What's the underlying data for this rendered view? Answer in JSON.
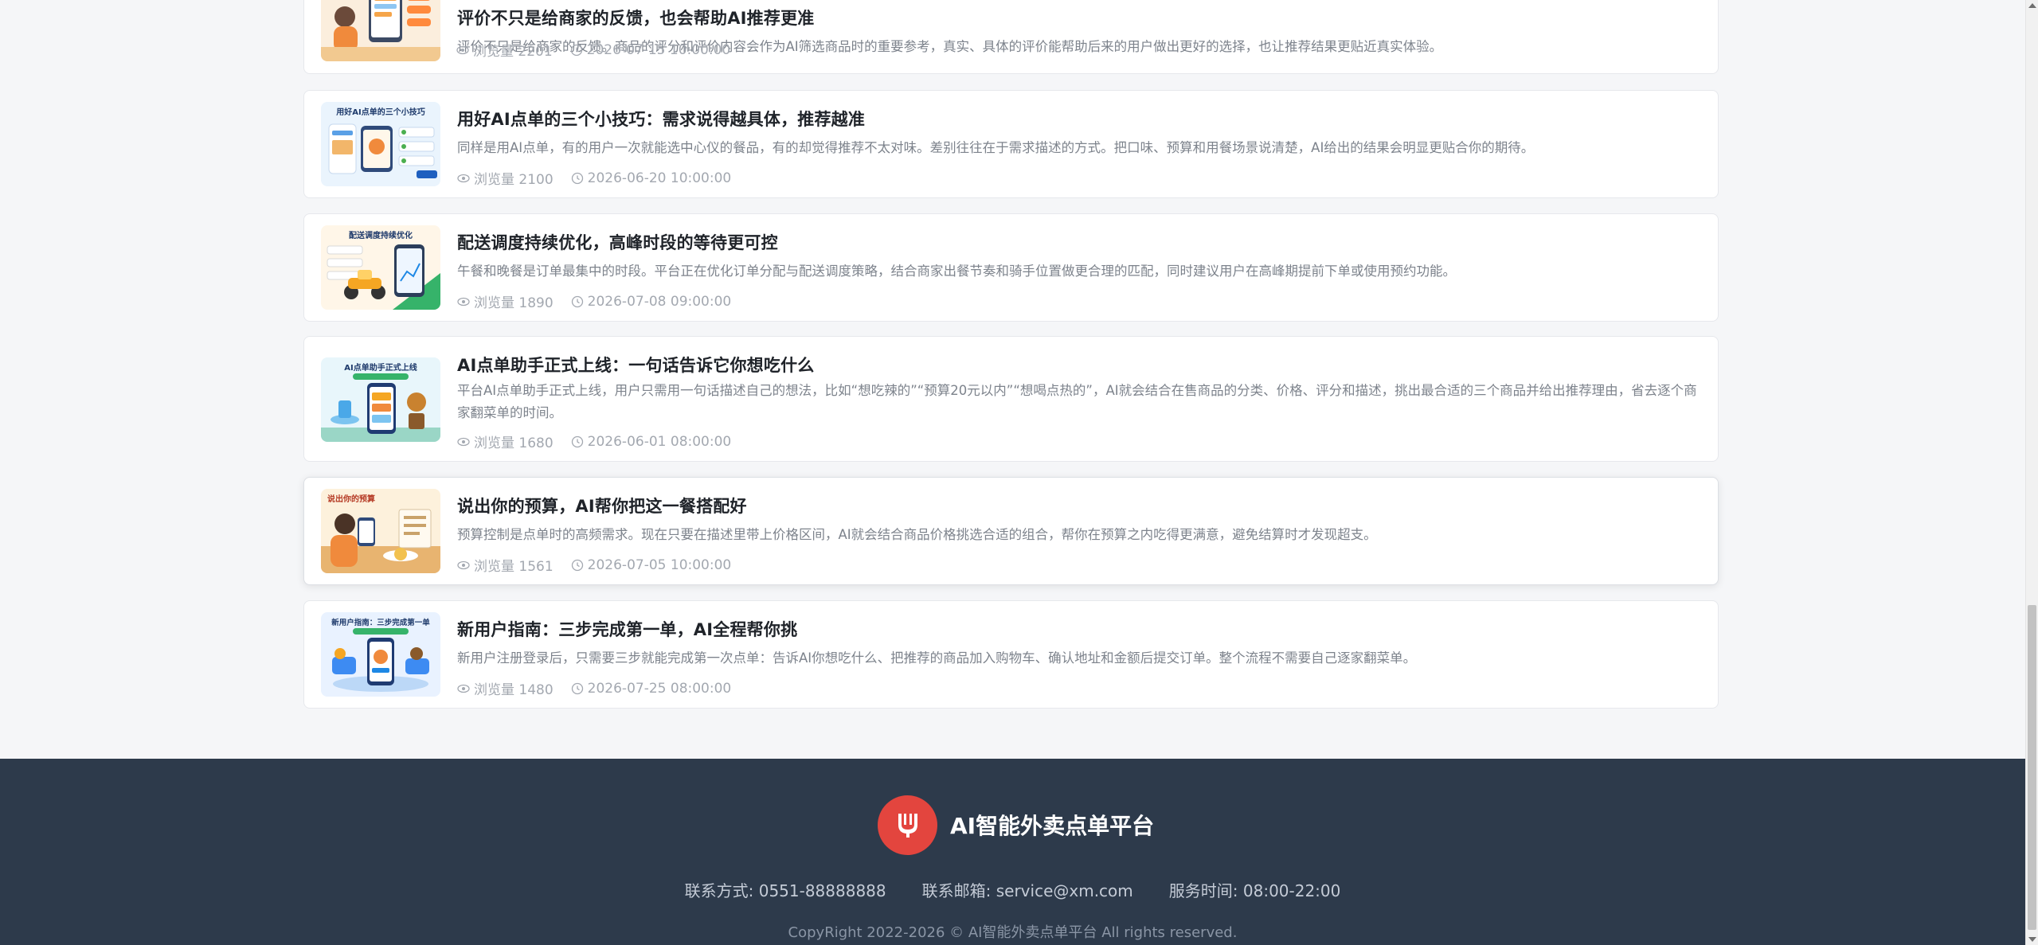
{
  "articles": [
    {
      "title": "评价不只是给商家的反馈，也会帮助AI推荐更准",
      "summary": "评价不只是给商家的反馈。商品的评分和评价内容会作为AI筛选商品时的重要参考，真实、具体的评价能帮助后来的用户做出更好的选择，也让推荐结果更贴近真实体验。",
      "views": "浏览量 2201",
      "date": "2026-07-15 10:00:00",
      "thumb_icon": "review-illustration"
    },
    {
      "title": "用好AI点单的三个小技巧：需求说得越具体，推荐越准",
      "summary": "同样是用AI点单，有的用户一次就能选中心仪的餐品，有的却觉得推荐不太对味。差别往往在于需求描述的方式。把口味、预算和用餐场景说清楚，AI给出的结果会明显更贴合你的期待。",
      "views": "浏览量 2100",
      "date": "2026-06-20 10:00:00",
      "thumb_text": "用好AI点单的三个小技巧",
      "thumb_icon": "tips-illustration"
    },
    {
      "title": "配送调度持续优化，高峰时段的等待更可控",
      "summary": "午餐和晚餐是订单最集中的时段。平台正在优化订单分配与配送调度策略，结合商家出餐节奏和骑手位置做更合理的匹配，同时建议用户在高峰期提前下单或使用预约功能。",
      "views": "浏览量 1890",
      "date": "2026-07-08 09:00:00",
      "thumb_text": "配送调度持续优化",
      "thumb_icon": "delivery-illustration"
    },
    {
      "title": "AI点单助手正式上线：一句话告诉它你想吃什么",
      "summary": "平台AI点单助手正式上线，用户只需用一句话描述自己的想法，比如“想吃辣的”“预算20元以内”“想喝点热的”，AI就会结合在售商品的分类、价格、评分和描述，挑出最合适的三个商品并给出推荐理由，省去逐个商家翻菜单的时间。",
      "views": "浏览量 1680",
      "date": "2026-06-01 08:00:00",
      "thumb_text": "AI点单助手正式上线",
      "thumb_icon": "assistant-illustration"
    },
    {
      "title": "说出你的预算，AI帮你把这一餐搭配好",
      "summary": "预算控制是点单时的高频需求。现在只要在描述里带上价格区间，AI就会结合商品价格挑选合适的组合，帮你在预算之内吃得更满意，避免结算时才发现超支。",
      "views": "浏览量 1561",
      "date": "2026-07-05 10:00:00",
      "thumb_text": "说出你的预算",
      "thumb_icon": "budget-illustration"
    },
    {
      "title": "新用户指南：三步完成第一单，AI全程帮你挑",
      "summary": "新用户注册登录后，只需要三步就能完成第一次点单：告诉AI你想吃什么、把推荐的商品加入购物车、确认地址和金额后提交订单。整个流程不需要自己逐家翻菜单。",
      "views": "浏览量 1480",
      "date": "2026-07-25 08:00:00",
      "thumb_text": "新用户指南：三步完成第一单",
      "thumb_icon": "guide-illustration"
    }
  ],
  "footer": {
    "brand": "AI智能外卖点单平台",
    "logo_icon": "fork-knife-icon",
    "contact": "联系方式: 0551-88888888",
    "email": "联系邮箱: service@xm.com",
    "hours": "服务时间: 08:00-22:00",
    "copyright": "CopyRight 2022-2026 © AI智能外卖点单平台 All rights reserved."
  },
  "colors": {
    "footer_bg": "#2d3a4b",
    "logo_red": "#e3453e",
    "title_text": "#1f2329",
    "muted_text": "#a3a8b0"
  }
}
